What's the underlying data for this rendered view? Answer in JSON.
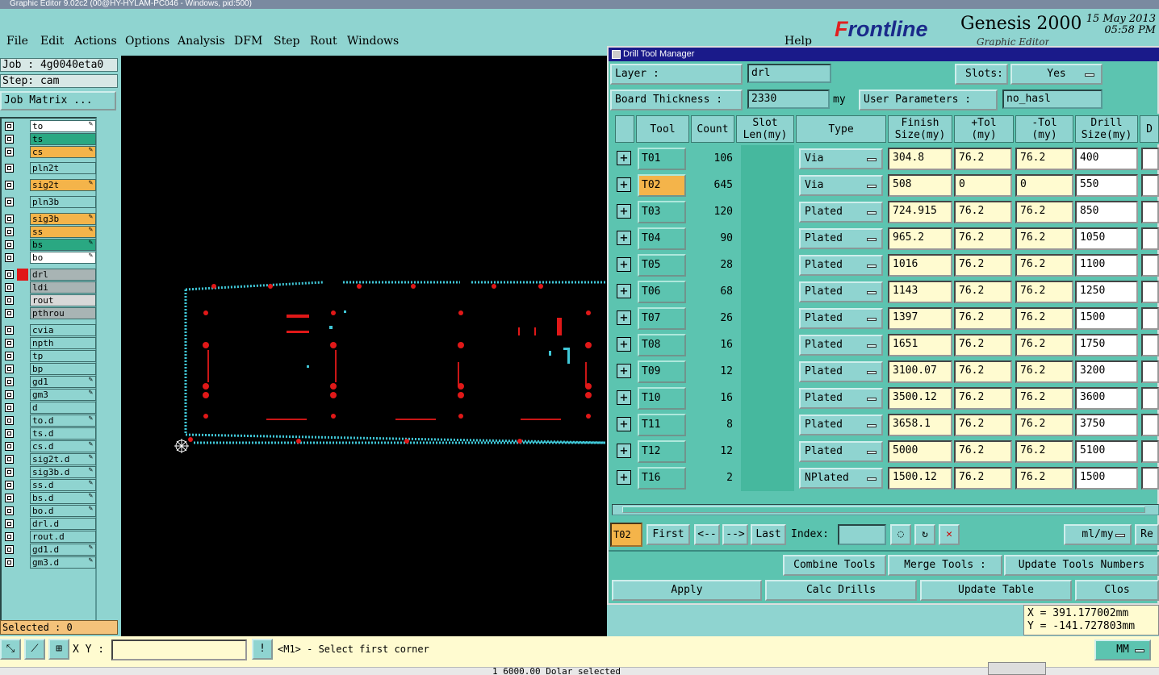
{
  "window": {
    "title": "Graphic Editor 9.02c2 (00@HY-HYLAM-PC046 - Windows, pid:500)"
  },
  "menu": {
    "file": "File",
    "edit": "Edit",
    "actions": "Actions",
    "options": "Options",
    "analysis": "Analysis",
    "dfm": "DFM",
    "step": "Step",
    "rout": "Rout",
    "windows": "Windows",
    "help": "Help"
  },
  "brand": {
    "logo_f": "F",
    "logo_rest": "rontline",
    "product": "Genesis 2000",
    "date": "15 May 2013",
    "time": "05:58 PM",
    "subtitle": "Graphic Editor"
  },
  "job": {
    "job_line": "Job : 4g0040eta0",
    "step_line": "Step: cam",
    "matrix_btn": "Job Matrix ..."
  },
  "layers": [
    {
      "name": "to",
      "color": "#ffffff",
      "pen": true
    },
    {
      "name": "ts",
      "color": "#2aa882",
      "pen": false
    },
    {
      "name": "cs",
      "color": "#f4b44a",
      "pen": true
    },
    {
      "name": "pln2t",
      "color": "#8fd4d0",
      "pen": false
    },
    {
      "name": "sig2t",
      "color": "#f4b44a",
      "pen": true
    },
    {
      "name": "pln3b",
      "color": "#8fd4d0",
      "pen": false
    },
    {
      "name": "sig3b",
      "color": "#f4b44a",
      "pen": true
    },
    {
      "name": "ss",
      "color": "#f4b44a",
      "pen": true
    },
    {
      "name": "bs",
      "color": "#2aa882",
      "pen": true
    },
    {
      "name": "bo",
      "color": "#ffffff",
      "pen": true
    },
    {
      "name": "drl",
      "color": "#a8b4b4",
      "pen": false
    },
    {
      "name": "ldi",
      "color": "#a8b4b4",
      "pen": false
    },
    {
      "name": "rout",
      "color": "#d8d8d8",
      "pen": false
    },
    {
      "name": "pthrou",
      "color": "#a8b4b4",
      "pen": false
    },
    {
      "name": "cvia",
      "color": "#8fd4d0",
      "pen": false
    },
    {
      "name": "npth",
      "color": "#8fd4d0",
      "pen": false
    },
    {
      "name": "tp",
      "color": "#8fd4d0",
      "pen": false
    },
    {
      "name": "bp",
      "color": "#8fd4d0",
      "pen": false
    },
    {
      "name": "gd1",
      "color": "#8fd4d0",
      "pen": true
    },
    {
      "name": "gm3",
      "color": "#8fd4d0",
      "pen": true
    },
    {
      "name": "d",
      "color": "#8fd4d0",
      "pen": false
    },
    {
      "name": "to.d",
      "color": "#8fd4d0",
      "pen": true
    },
    {
      "name": "ts.d",
      "color": "#8fd4d0",
      "pen": false
    },
    {
      "name": "cs.d",
      "color": "#8fd4d0",
      "pen": true
    },
    {
      "name": "sig2t.d",
      "color": "#8fd4d0",
      "pen": true
    },
    {
      "name": "sig3b.d",
      "color": "#8fd4d0",
      "pen": true
    },
    {
      "name": "ss.d",
      "color": "#8fd4d0",
      "pen": true
    },
    {
      "name": "bs.d",
      "color": "#8fd4d0",
      "pen": true
    },
    {
      "name": "bo.d",
      "color": "#8fd4d0",
      "pen": true
    },
    {
      "name": "drl.d",
      "color": "#8fd4d0",
      "pen": false
    },
    {
      "name": "rout.d",
      "color": "#8fd4d0",
      "pen": false
    },
    {
      "name": "gd1.d",
      "color": "#8fd4d0",
      "pen": true
    },
    {
      "name": "gm3.d",
      "color": "#8fd4d0",
      "pen": true
    }
  ],
  "selected": "Selected : 0",
  "dialog": {
    "title": "Drill Tool Manager",
    "layer_label": "Layer :",
    "layer_value": "drl",
    "slots_label": "Slots:",
    "slots_value": "Yes",
    "thickness_label": "Board Thickness :",
    "thickness_value": "2330",
    "thickness_unit": "my",
    "user_params_label": "User Parameters :",
    "user_params_value": "no_hasl",
    "headers": {
      "tool": "Tool",
      "count": "Count",
      "slot": "Slot\nLen(my)",
      "type": "Type",
      "finish": "Finish\nSize(my)",
      "ptol": "+Tol\n(my)",
      "mtol": "-Tol\n(my)",
      "drill": "Drill\nSize(my)",
      "extra": "D"
    },
    "rows": [
      {
        "tool": "T01",
        "count": "106",
        "type": "Via",
        "finish": "304.8",
        "ptol": "76.2",
        "mtol": "76.2",
        "drill": "400"
      },
      {
        "tool": "T02",
        "count": "645",
        "type": "Via",
        "finish": "508",
        "ptol": "0",
        "mtol": "0",
        "drill": "550"
      },
      {
        "tool": "T03",
        "count": "120",
        "type": "Plated",
        "finish": "724.915",
        "ptol": "76.2",
        "mtol": "76.2",
        "drill": "850"
      },
      {
        "tool": "T04",
        "count": "90",
        "type": "Plated",
        "finish": "965.2",
        "ptol": "76.2",
        "mtol": "76.2",
        "drill": "1050"
      },
      {
        "tool": "T05",
        "count": "28",
        "type": "Plated",
        "finish": "1016",
        "ptol": "76.2",
        "mtol": "76.2",
        "drill": "1100"
      },
      {
        "tool": "T06",
        "count": "68",
        "type": "Plated",
        "finish": "1143",
        "ptol": "76.2",
        "mtol": "76.2",
        "drill": "1250"
      },
      {
        "tool": "T07",
        "count": "26",
        "type": "Plated",
        "finish": "1397",
        "ptol": "76.2",
        "mtol": "76.2",
        "drill": "1500"
      },
      {
        "tool": "T08",
        "count": "16",
        "type": "Plated",
        "finish": "1651",
        "ptol": "76.2",
        "mtol": "76.2",
        "drill": "1750"
      },
      {
        "tool": "T09",
        "count": "12",
        "type": "Plated",
        "finish": "3100.07",
        "ptol": "76.2",
        "mtol": "76.2",
        "drill": "3200"
      },
      {
        "tool": "T10",
        "count": "16",
        "type": "Plated",
        "finish": "3500.12",
        "ptol": "76.2",
        "mtol": "76.2",
        "drill": "3600"
      },
      {
        "tool": "T11",
        "count": "8",
        "type": "Plated",
        "finish": "3658.1",
        "ptol": "76.2",
        "mtol": "76.2",
        "drill": "3750"
      },
      {
        "tool": "T12",
        "count": "12",
        "type": "Plated",
        "finish": "5000",
        "ptol": "76.2",
        "mtol": "76.2",
        "drill": "5100"
      },
      {
        "tool": "T16",
        "count": "2",
        "type": "NPlated",
        "finish": "1500.12",
        "ptol": "76.2",
        "mtol": "76.2",
        "drill": "1500"
      }
    ],
    "selected_tool": "T02",
    "nav": {
      "first": "First",
      "prev": "<--",
      "next": "-->",
      "last": "Last",
      "index_label": "Index:",
      "units": "ml/my",
      "re": "Re"
    },
    "actions": {
      "combine": "Combine Tools",
      "merge": "Merge Tools :",
      "update_numbers": "Update Tools Numbers",
      "apply": "Apply",
      "calc": "Calc Drills",
      "update_table": "Update Table",
      "close": "Clos"
    }
  },
  "coords": {
    "x": "X = 391.177002mm",
    "y": "Y = -141.727803mm"
  },
  "status": {
    "xy_label": "X Y :",
    "message": "<M1> - Select first corner",
    "units": "MM",
    "bottom": "1 6000.00 Dolar selected"
  }
}
